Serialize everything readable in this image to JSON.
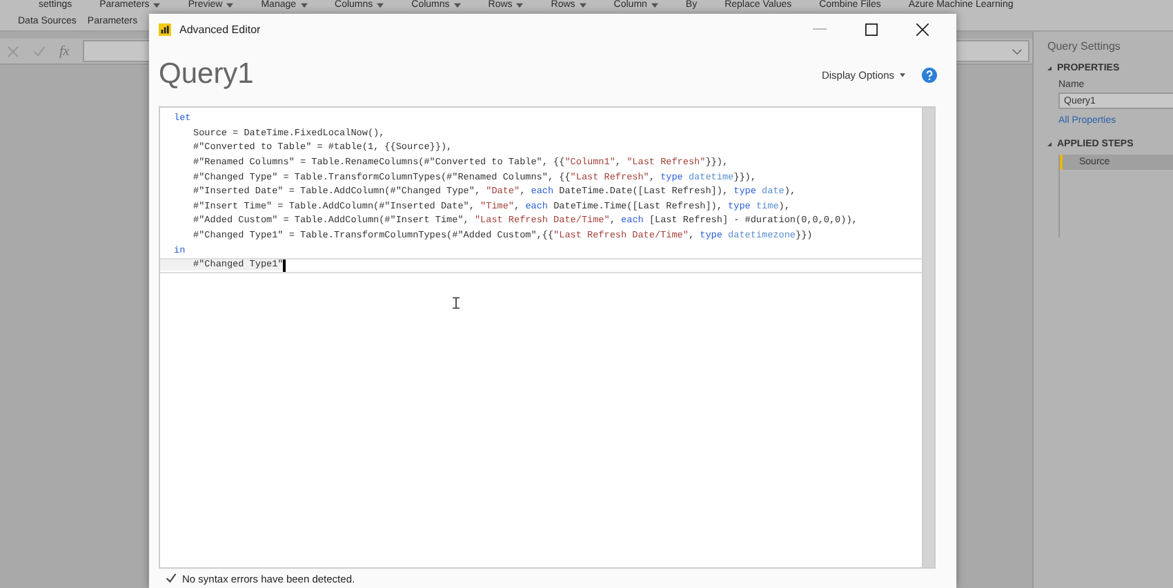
{
  "ribbon": {
    "top_row": [
      {
        "label": "settings",
        "dropdown": false
      },
      {
        "label": "Parameters",
        "dropdown": true
      },
      {
        "label": "Preview",
        "dropdown": true
      },
      {
        "label": "Manage",
        "dropdown": true
      },
      {
        "label": "Columns",
        "dropdown": true
      },
      {
        "label": "Columns",
        "dropdown": true
      },
      {
        "label": "Rows",
        "dropdown": true
      },
      {
        "label": "Rows",
        "dropdown": true
      },
      {
        "label": "Column",
        "dropdown": true
      },
      {
        "label": "By",
        "dropdown": false
      },
      {
        "label": "Replace Values",
        "dropdown": false
      },
      {
        "label": "Combine Files",
        "dropdown": false
      },
      {
        "label": "Azure Machine Learning",
        "dropdown": false
      }
    ],
    "groups": [
      "Data Sources",
      "Parameters"
    ]
  },
  "formula_bar": {
    "fx": "fx"
  },
  "query_settings": {
    "title": "Query Settings",
    "properties_heading": "PROPERTIES",
    "name_label": "Name",
    "name_value": "Query1",
    "all_properties_link": "All Properties",
    "applied_steps_heading": "APPLIED STEPS",
    "steps": [
      {
        "label": "Source",
        "selected": true
      }
    ]
  },
  "dialog": {
    "title": "Advanced Editor",
    "query_title": "Query1",
    "display_options": "Display Options",
    "code_lines": [
      {
        "indented": false,
        "current": false,
        "tokens": [
          {
            "kind": "keyword",
            "text": "let"
          }
        ]
      },
      {
        "indented": true,
        "current": false,
        "tokens": [
          {
            "kind": "plain",
            "text": "Source = DateTime.FixedLocalNow(),"
          }
        ]
      },
      {
        "indented": true,
        "current": false,
        "tokens": [
          {
            "kind": "plain",
            "text": "#\"Converted to Table\" = #table(1, {{Source}}),"
          }
        ]
      },
      {
        "indented": true,
        "current": false,
        "tokens": [
          {
            "kind": "plain",
            "text": "#\"Renamed Columns\" = Table.RenameColumns(#\"Converted to Table\", {{"
          },
          {
            "kind": "string",
            "text": "\"Column1\""
          },
          {
            "kind": "plain",
            "text": ", "
          },
          {
            "kind": "string",
            "text": "\"Last Refresh\""
          },
          {
            "kind": "plain",
            "text": "}}),"
          }
        ]
      },
      {
        "indented": true,
        "current": false,
        "tokens": [
          {
            "kind": "plain",
            "text": "#\"Changed Type\" = Table.TransformColumnTypes(#\"Renamed Columns\", {{"
          },
          {
            "kind": "string",
            "text": "\"Last Refresh\""
          },
          {
            "kind": "plain",
            "text": ", "
          },
          {
            "kind": "keyword",
            "text": "type"
          },
          {
            "kind": "typename",
            "text": " datetime"
          },
          {
            "kind": "plain",
            "text": "}}),"
          }
        ]
      },
      {
        "indented": true,
        "current": false,
        "tokens": [
          {
            "kind": "plain",
            "text": "#\"Inserted Date\" = Table.AddColumn(#\"Changed Type\", "
          },
          {
            "kind": "string",
            "text": "\"Date\""
          },
          {
            "kind": "plain",
            "text": ", "
          },
          {
            "kind": "keyword",
            "text": "each"
          },
          {
            "kind": "plain",
            "text": " DateTime.Date([Last Refresh]), "
          },
          {
            "kind": "keyword",
            "text": "type"
          },
          {
            "kind": "typename",
            "text": " date"
          },
          {
            "kind": "plain",
            "text": "),"
          }
        ]
      },
      {
        "indented": true,
        "current": false,
        "tokens": [
          {
            "kind": "plain",
            "text": "#\"Insert Time\" = Table.AddColumn(#\"Inserted Date\", "
          },
          {
            "kind": "string",
            "text": "\"Time\""
          },
          {
            "kind": "plain",
            "text": ", "
          },
          {
            "kind": "keyword",
            "text": "each"
          },
          {
            "kind": "plain",
            "text": " DateTime.Time([Last Refresh]), "
          },
          {
            "kind": "keyword",
            "text": "type"
          },
          {
            "kind": "typename",
            "text": " time"
          },
          {
            "kind": "plain",
            "text": "),"
          }
        ]
      },
      {
        "indented": true,
        "current": false,
        "tokens": [
          {
            "kind": "plain",
            "text": "#\"Added Custom\" = Table.AddColumn(#\"Insert Time\", "
          },
          {
            "kind": "string",
            "text": "\"Last Refresh Date/Time\""
          },
          {
            "kind": "plain",
            "text": ", "
          },
          {
            "kind": "keyword",
            "text": "each"
          },
          {
            "kind": "plain",
            "text": " [Last Refresh] - #duration(0,0,0,0)),"
          }
        ]
      },
      {
        "indented": true,
        "current": false,
        "tokens": [
          {
            "kind": "plain",
            "text": "#\"Changed Type1\" = Table.TransformColumnTypes(#\"Added Custom\",{{"
          },
          {
            "kind": "string",
            "text": "\"Last Refresh Date/Time\""
          },
          {
            "kind": "plain",
            "text": ", "
          },
          {
            "kind": "keyword",
            "text": "type"
          },
          {
            "kind": "typename",
            "text": " datetimezone"
          },
          {
            "kind": "plain",
            "text": "}})"
          }
        ]
      },
      {
        "indented": false,
        "current": false,
        "tokens": [
          {
            "kind": "keyword",
            "text": "in"
          }
        ]
      },
      {
        "indented": true,
        "current": true,
        "tokens": [
          {
            "kind": "plain",
            "text": "#\"Changed Type1\""
          }
        ]
      }
    ],
    "status": "No syntax errors have been detected."
  }
}
